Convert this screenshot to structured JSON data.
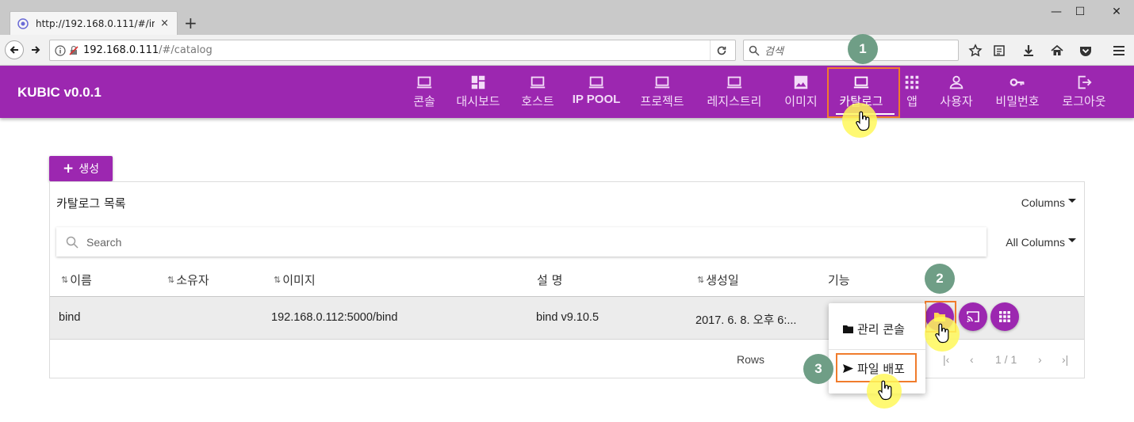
{
  "browser": {
    "tab_title": "http://192.168.0.111/#/imag",
    "tab_close": "×",
    "new_tab": "+",
    "url_host": "192.168.0.111",
    "url_path": "/#/catalog",
    "search_placeholder": "검색",
    "window_controls": [
      "—",
      "☐",
      "✕"
    ]
  },
  "app": {
    "brand": "KUBIC v0.0.1",
    "menu": [
      {
        "label": "콘솔",
        "icon": "laptop-icon"
      },
      {
        "label": "대시보드",
        "icon": "dashboard-icon"
      },
      {
        "label": "호스트",
        "icon": "laptop-icon"
      },
      {
        "label": "IP POOL",
        "icon": "laptop-icon"
      },
      {
        "label": "프로젝트",
        "icon": "laptop-icon"
      },
      {
        "label": "레지스트리",
        "icon": "laptop-icon"
      },
      {
        "label": "이미지",
        "icon": "image-icon"
      },
      {
        "label": "카탈로그",
        "icon": "laptop-icon",
        "active": true
      },
      {
        "label": "앱",
        "icon": "apps-grid-icon"
      },
      {
        "label": "사용자",
        "icon": "person-icon"
      },
      {
        "label": "비밀번호",
        "icon": "key-icon"
      },
      {
        "label": "로그아웃",
        "icon": "logout-icon"
      }
    ]
  },
  "content": {
    "create_label": "생성",
    "panel_title": "카탈로그 목록",
    "columns_label": "Columns",
    "search_placeholder": "Search",
    "all_columns_label": "All Columns",
    "headers": {
      "name": "이름",
      "owner": "소유자",
      "image": "이미지",
      "description": "설 명",
      "created": "생성일",
      "actions": "기능"
    },
    "row": {
      "name": "bind",
      "owner": "",
      "image": "192.168.0.112:5000/bind",
      "description": "bind v9.10.5",
      "created": "2017. 6. 8. 오후 6:..."
    },
    "rows_label": "Rows",
    "page_info": "1 / 1"
  },
  "dropdown": {
    "item1": "관리 콘솔",
    "item2": "파일 배포"
  },
  "callouts": [
    "1",
    "2",
    "3"
  ],
  "colors": {
    "primary": "#9c27b0",
    "highlight_border": "#f07c2c",
    "callout": "#6f9e86",
    "glow": "#fff85a"
  }
}
